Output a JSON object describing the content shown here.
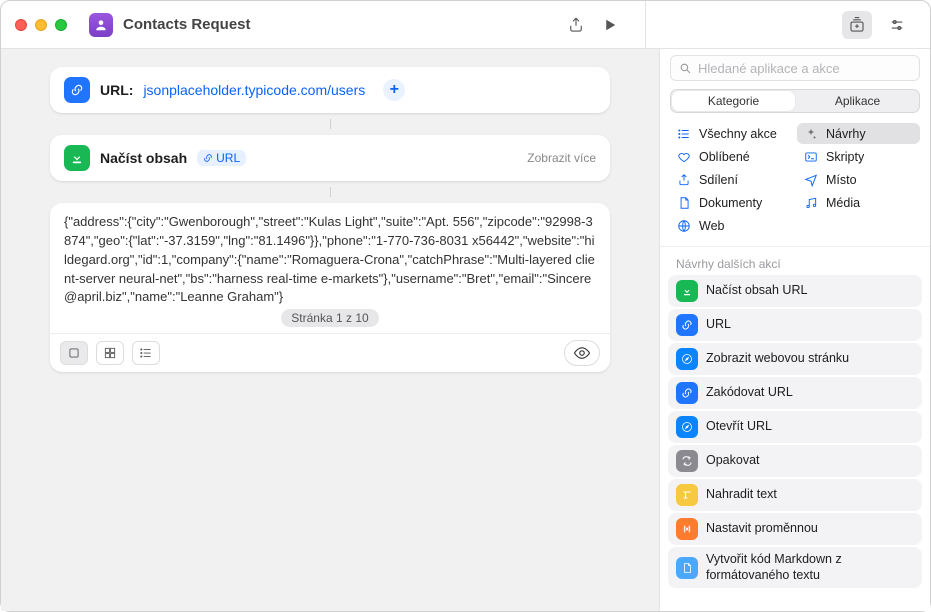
{
  "title": "Contacts Request",
  "toolbar": {
    "share": "share-icon",
    "run": "play-icon"
  },
  "url_action": {
    "label": "URL:",
    "value": "jsonplaceholder.typicode.com/users"
  },
  "load_action": {
    "title": "Načíst obsah",
    "token": "URL",
    "more": "Zobrazit více"
  },
  "result": {
    "text": "{\"address\":{\"city\":\"Gwenborough\",\"street\":\"Kulas Light\",\"suite\":\"Apt. 556\",\"zipcode\":\"92998-3874\",\"geo\":{\"lat\":\"-37.3159\",\"lng\":\"81.1496\"}},\"phone\":\"1-770-736-8031 x56442\",\"website\":\"hildegard.org\",\"id\":1,\"company\":{\"name\":\"Romaguera-Crona\",\"catchPhrase\":\"Multi-layered client-server neural-net\",\"bs\":\"harness real-time e-markets\"},\"username\":\"Bret\",\"email\":\"Sincere@april.biz\",\"name\":\"Leanne Graham\"}",
    "page": "Stránka 1 z 10"
  },
  "sidebar": {
    "search_placeholder": "Hledané aplikace a akce",
    "segments": [
      "Kategorie",
      "Aplikace"
    ],
    "categories": [
      {
        "label": "Všechny akce",
        "icon": "list",
        "color": "#0a63ff"
      },
      {
        "label": "Návrhy",
        "icon": "sparkle",
        "color": "#6b6b70",
        "sel": true
      },
      {
        "label": "Oblíbené",
        "icon": "heart",
        "color": "#0a63ff"
      },
      {
        "label": "Skripty",
        "icon": "terminal",
        "color": "#0a63ff"
      },
      {
        "label": "Sdílení",
        "icon": "share",
        "color": "#0a63ff"
      },
      {
        "label": "Místo",
        "icon": "location",
        "color": "#0a63ff"
      },
      {
        "label": "Dokumenty",
        "icon": "doc",
        "color": "#0a63ff"
      },
      {
        "label": "Média",
        "icon": "music",
        "color": "#0a63ff"
      },
      {
        "label": "Web",
        "icon": "globe",
        "color": "#0a63ff"
      }
    ],
    "section_label": "Návrhy dalších akcí",
    "suggestions": [
      {
        "label": "Načíst obsah URL",
        "bg": "#18b955",
        "icon": "download"
      },
      {
        "label": "URL",
        "bg": "#1f75ff",
        "icon": "link"
      },
      {
        "label": "Zobrazit webovou stránku",
        "bg": "#0a84ff",
        "icon": "safari"
      },
      {
        "label": "Zakódovat URL",
        "bg": "#1f75ff",
        "icon": "link"
      },
      {
        "label": "Otevřít URL",
        "bg": "#0a84ff",
        "icon": "safari"
      },
      {
        "label": "Opakovat",
        "bg": "#8a8a90",
        "icon": "repeat"
      },
      {
        "label": "Nahradit text",
        "bg": "#f7c940",
        "icon": "text"
      },
      {
        "label": "Nastavit proměnnou",
        "bg": "#ff7b2e",
        "icon": "var"
      },
      {
        "label": "Vytvořit kód Markdown z formátovaného textu",
        "bg": "#4aa8ff",
        "icon": "doc"
      }
    ]
  }
}
